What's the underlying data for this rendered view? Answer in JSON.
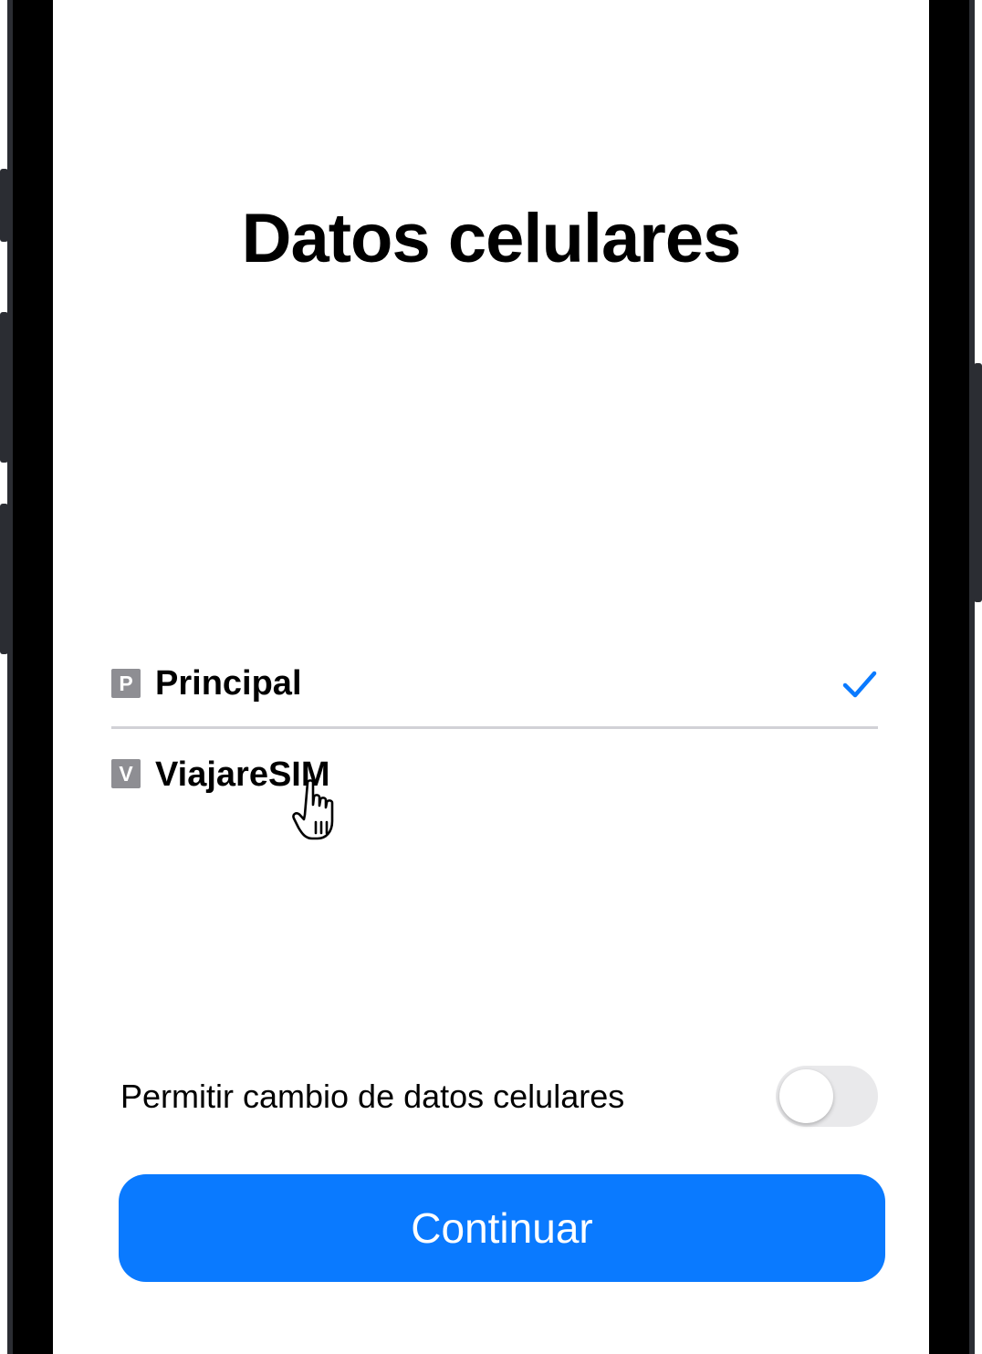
{
  "screen": {
    "title": "Datos celulares"
  },
  "sim_lines": [
    {
      "badge": "P",
      "name": "Principal",
      "selected": true
    },
    {
      "badge": "V",
      "name": "ViajareSIM",
      "selected": false
    }
  ],
  "data_switching": {
    "label": "Permitir cambio de datos celulares",
    "enabled": false
  },
  "actions": {
    "continue_label": "Continuar"
  },
  "colors": {
    "accent": "#0a7aff",
    "badge": "#8e8e93",
    "toggle_off": "#e9e9eb",
    "divider": "#d1d1d6"
  },
  "icons": {
    "selected_marker": "checkmark-icon",
    "pointer": "hand-pointer-cursor"
  }
}
